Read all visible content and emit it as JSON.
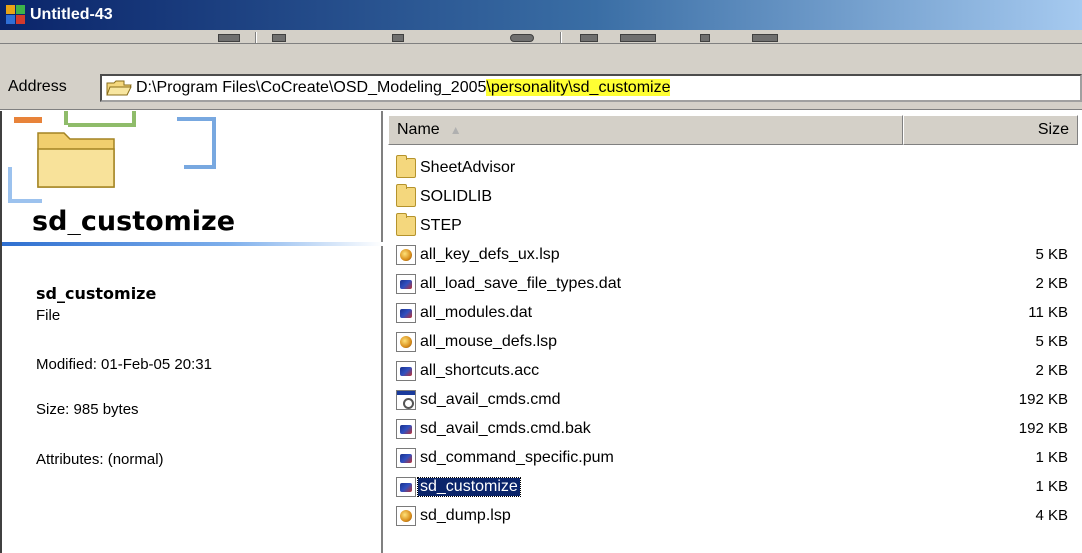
{
  "window": {
    "title": "Untitled-43"
  },
  "address": {
    "label": "Address",
    "path_prefix": "D:\\Program Files\\CoCreate\\OSD_Modeling_2005",
    "path_highlighted": "\\personality\\sd_customize"
  },
  "info_pane": {
    "folder_title": "sd_customize",
    "item_name": "sd_customize",
    "item_type": "File",
    "modified": "Modified: 01-Feb-05 20:31",
    "size": "Size: 985 bytes",
    "attributes": "Attributes: (normal)"
  },
  "columns": {
    "name": "Name",
    "size": "Size"
  },
  "files": [
    {
      "name": "SheetAdvisor",
      "size": "",
      "icon": "folder-icon"
    },
    {
      "name": "SOLIDLIB",
      "size": "",
      "icon": "folder-icon"
    },
    {
      "name": "STEP",
      "size": "",
      "icon": "folder-icon"
    },
    {
      "name": "all_key_defs_ux.lsp",
      "size": "5 KB",
      "icon": "lisp-file-icon"
    },
    {
      "name": "all_load_save_file_types.dat",
      "size": "2 KB",
      "icon": "data-file-icon"
    },
    {
      "name": "all_modules.dat",
      "size": "11 KB",
      "icon": "data-file-icon"
    },
    {
      "name": "all_mouse_defs.lsp",
      "size": "5 KB",
      "icon": "lisp-file-icon"
    },
    {
      "name": "all_shortcuts.acc",
      "size": "2 KB",
      "icon": "data-file-icon"
    },
    {
      "name": "sd_avail_cmds.cmd",
      "size": "192 KB",
      "icon": "cmd-file-icon"
    },
    {
      "name": "sd_avail_cmds.cmd.bak",
      "size": "192 KB",
      "icon": "data-file-icon"
    },
    {
      "name": "sd_command_specific.pum",
      "size": "1 KB",
      "icon": "data-file-icon"
    },
    {
      "name": "sd_customize",
      "size": "1 KB",
      "icon": "data-file-icon",
      "selected": true
    },
    {
      "name": "sd_dump.lsp",
      "size": "4 KB",
      "icon": "lisp-file-icon"
    }
  ],
  "colors": {
    "title_bar_start": "#0a246a",
    "title_bar_end": "#a6caf0",
    "highlight": "#ffff33",
    "selection": "#0a246a"
  }
}
